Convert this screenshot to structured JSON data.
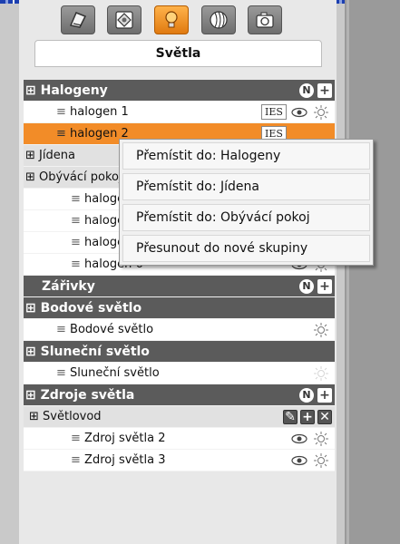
{
  "panel_title": "Světla",
  "toolbar": {
    "tools": [
      {
        "icon": "material-icon",
        "active": false
      },
      {
        "icon": "object-icon",
        "active": false
      },
      {
        "icon": "light-bulb-icon",
        "active": true
      },
      {
        "icon": "texture-icon",
        "active": false
      },
      {
        "icon": "camera-icon",
        "active": false
      }
    ]
  },
  "lights": {
    "halogeny": {
      "label": "Halogeny"
    },
    "halogen1": {
      "label": "halogen 1",
      "ies": "IES"
    },
    "halogen2": {
      "label": "halogen 2",
      "ies": "IES"
    },
    "jidena": {
      "label": "Jídena"
    },
    "obyvaci": {
      "label": "Obývácí pokoj"
    },
    "halogen3": {
      "label": "halogen 3"
    },
    "halogen4": {
      "label": "halogen 4"
    },
    "halogen5": {
      "label": "halogen 5"
    },
    "halogen6": {
      "label": "halogen 6"
    },
    "zarivky": {
      "label": "Zářivky"
    },
    "bodove": {
      "label": "Bodové  světlo"
    },
    "bodove_item": {
      "label": "Bodové  světlo"
    },
    "slunecni": {
      "label": "Sluneční světlo"
    },
    "slunecni_item": {
      "label": "Sluneční světlo"
    },
    "zdroje": {
      "label": "Zdroje světla"
    },
    "svetlovod": {
      "label": "Světlovod"
    },
    "zdroj2": {
      "label": "Zdroj světla 2"
    },
    "zdroj3": {
      "label": "Zdroj světla 3"
    }
  },
  "context_menu": {
    "items": [
      "Přemístit do: Halogeny",
      "Přemístit do: Jídena",
      "Přemístit do: Obývácí pokoj",
      "Přesunout do nové skupiny"
    ]
  },
  "colors": {
    "group_header": "#5b5b5b",
    "selected_row": "#f28c28",
    "active_tool": "#f0901e"
  }
}
